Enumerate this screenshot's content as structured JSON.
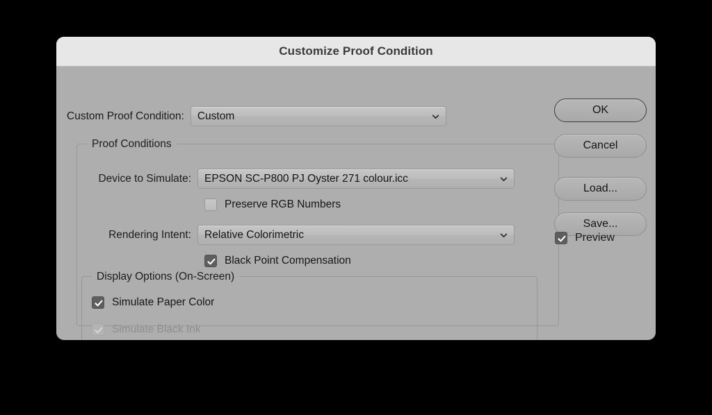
{
  "window": {
    "title": "Customize Proof Condition"
  },
  "top_row": {
    "label": "Custom Proof Condition:",
    "select_value": "Custom",
    "chevron_icon": "chevron-down-icon"
  },
  "proof_conditions": {
    "legend": "Proof Conditions",
    "device": {
      "label": "Device to Simulate:",
      "value": "EPSON SC-P800 PJ Oyster 271 colour.icc",
      "chevron_icon": "chevron-down-icon"
    },
    "preserve_rgb": {
      "label": "Preserve RGB Numbers",
      "checked": false,
      "disabled": false
    },
    "rendering_intent": {
      "label": "Rendering Intent:",
      "value": "Relative Colorimetric",
      "chevron_icon": "chevron-down-icon"
    },
    "black_point_compensation": {
      "label": "Black Point Compensation",
      "checked": true,
      "disabled": false
    },
    "display_options": {
      "legend": "Display Options (On-Screen)",
      "simulate_paper_color": {
        "label": "Simulate Paper Color",
        "checked": true,
        "disabled": false
      },
      "simulate_black_ink": {
        "label": "Simulate Black Ink",
        "checked": true,
        "disabled": true
      }
    }
  },
  "buttons": {
    "ok": "OK",
    "cancel": "Cancel",
    "load": "Load...",
    "save": "Save..."
  },
  "preview": {
    "label": "Preview",
    "checked": true
  },
  "colors": {
    "dialog_background": "#aeaeae",
    "titlebar_background": "#e7e7e7",
    "desktop_background": "#000000",
    "checkbox_checked": "#5e5e5e",
    "text": "#1c1c1c",
    "disabled_text": "#8e8e8e"
  }
}
